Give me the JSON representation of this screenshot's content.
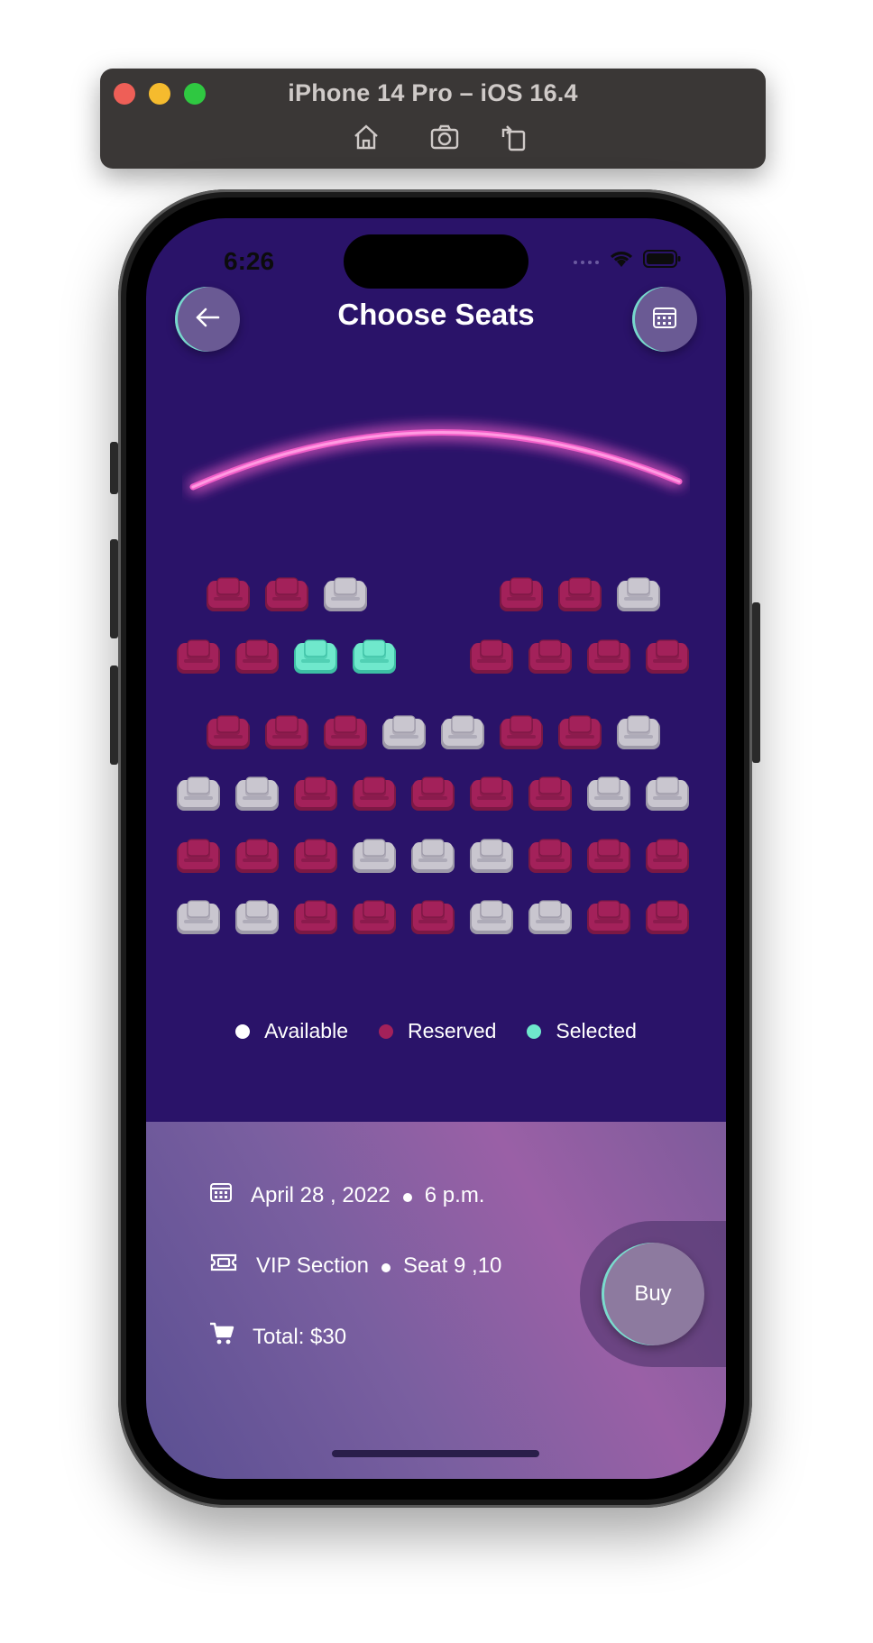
{
  "simulator": {
    "title": "iPhone 14 Pro – iOS 16.4",
    "tools": [
      "home-icon",
      "screenshot-icon",
      "rotate-icon"
    ]
  },
  "status_bar": {
    "time": "6:26",
    "icons": [
      "signal-icon",
      "wifi-icon",
      "battery-icon"
    ]
  },
  "header": {
    "title": "Choose Seats",
    "back_icon": "arrow-left-icon",
    "calendar_icon": "calendar-icon"
  },
  "colors": {
    "background": "#2a1369",
    "available": "#c9c6cf",
    "reserved": "#a3215a",
    "selected": "#6fe8cc",
    "screen_glow": "#f25fc9"
  },
  "seat_rows": [
    [
      "gap",
      "reserved",
      "reserved",
      "available",
      "gap",
      "gap",
      "reserved",
      "reserved",
      "available",
      "gap"
    ],
    [
      "reserved",
      "reserved",
      "selected",
      "selected",
      "gap",
      "reserved",
      "reserved",
      "reserved",
      "reserved"
    ],
    [
      "gap",
      "reserved",
      "reserved",
      "reserved",
      "available",
      "available",
      "reserved",
      "reserved",
      "available",
      "gap"
    ],
    [
      "available",
      "available",
      "reserved",
      "reserved",
      "reserved",
      "reserved",
      "reserved",
      "available",
      "available"
    ],
    [
      "reserved",
      "reserved",
      "reserved",
      "available",
      "available",
      "available",
      "reserved",
      "reserved",
      "reserved"
    ],
    [
      "available",
      "available",
      "reserved",
      "reserved",
      "reserved",
      "available",
      "available",
      "reserved",
      "reserved"
    ]
  ],
  "legend": [
    {
      "label": "Available",
      "color": "#ffffff"
    },
    {
      "label": "Reserved",
      "color": "#a3215a"
    },
    {
      "label": "Selected",
      "color": "#6fe8cc"
    }
  ],
  "booking": {
    "date": "April 28 , 2022",
    "time": "6 p.m.",
    "section": "VIP Section",
    "seats": "Seat 9 ,10",
    "total": "Total: $30",
    "buy_label": "Buy"
  }
}
